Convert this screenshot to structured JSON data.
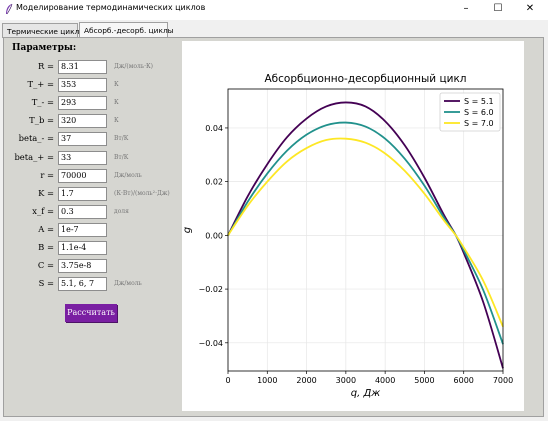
{
  "window": {
    "title": "Моделирование термодинамических циклов",
    "minimize": "–",
    "maximize": "☐",
    "close": "✕"
  },
  "tabs": [
    {
      "label": "Термические циклы",
      "active": false
    },
    {
      "label": "Абсорб.-десорб. циклы",
      "active": true
    }
  ],
  "params": {
    "title": "Параметры:",
    "rows": [
      {
        "label": "R =",
        "value": "8.31",
        "unit": "Дж/(моль·К)"
      },
      {
        "label": "T_+ =",
        "value": "353",
        "unit": "К"
      },
      {
        "label": "T_- =",
        "value": "293",
        "unit": "К"
      },
      {
        "label": "T_b =",
        "value": "320",
        "unit": "К"
      },
      {
        "label": "beta_- =",
        "value": "37",
        "unit": "Вт/К"
      },
      {
        "label": "beta_+ =",
        "value": "33",
        "unit": "Вт/К"
      },
      {
        "label": "r =",
        "value": "70000",
        "unit": "Дж/моль"
      },
      {
        "label": "K =",
        "value": "1.7",
        "unit": "(К·Вт)/(моль²·Дж)"
      },
      {
        "label": "x_f =",
        "value": "0.3",
        "unit": "доля"
      },
      {
        "label": "A =",
        "value": "1e-7",
        "unit": ""
      },
      {
        "label": "B =",
        "value": "1.1e-4",
        "unit": ""
      },
      {
        "label": "C =",
        "value": "3.75e-8",
        "unit": ""
      },
      {
        "label": "S =",
        "value": "5.1, 6, 7",
        "unit": "Дж/моль"
      }
    ],
    "button": "Рассчитать"
  },
  "chart_data": {
    "type": "line",
    "title": "Абсорбционно-десорбционный цикл",
    "xlabel": "q, Дж",
    "ylabel": "g",
    "xlim": [
      0,
      7000
    ],
    "ylim": [
      -0.0505,
      0.0545
    ],
    "xticks": [
      "0",
      "1000",
      "2000",
      "3000",
      "4000",
      "5000",
      "6000",
      "7000"
    ],
    "yticks": [
      "−0.04",
      "−0.02",
      "0.00",
      "0.02",
      "0.04"
    ],
    "grid": true,
    "legend_position": "top-right",
    "series": [
      {
        "name": "S = 5.1",
        "color": "#440154",
        "x": [
          0,
          500,
          1000,
          1500,
          2000,
          2500,
          3000,
          3500,
          4000,
          4500,
          5000,
          5500,
          5800,
          6000,
          6500,
          7000
        ],
        "y": [
          0.0,
          0.0145,
          0.0265,
          0.0365,
          0.0435,
          0.048,
          0.0495,
          0.048,
          0.0425,
          0.0335,
          0.0215,
          0.0075,
          0.0,
          -0.0065,
          -0.025,
          -0.0495
        ]
      },
      {
        "name": "S = 6.0",
        "color": "#21918c",
        "x": [
          0,
          500,
          1000,
          1500,
          2000,
          2500,
          3000,
          3500,
          4000,
          4500,
          5000,
          5500,
          5800,
          6000,
          6500,
          7000
        ],
        "y": [
          0.0,
          0.0125,
          0.023,
          0.0315,
          0.0375,
          0.041,
          0.042,
          0.0405,
          0.036,
          0.0285,
          0.0185,
          0.0065,
          0.0,
          -0.0055,
          -0.0205,
          -0.0405
        ]
      },
      {
        "name": "S = 7.0",
        "color": "#fde725",
        "x": [
          0,
          500,
          1000,
          1500,
          2000,
          2500,
          3000,
          3500,
          4000,
          4500,
          5000,
          5500,
          5800,
          6000,
          6500,
          7000
        ],
        "y": [
          0.0,
          0.011,
          0.02,
          0.0275,
          0.0325,
          0.0355,
          0.036,
          0.0345,
          0.0305,
          0.024,
          0.0155,
          0.0055,
          0.0,
          -0.0045,
          -0.017,
          -0.034
        ]
      }
    ]
  }
}
